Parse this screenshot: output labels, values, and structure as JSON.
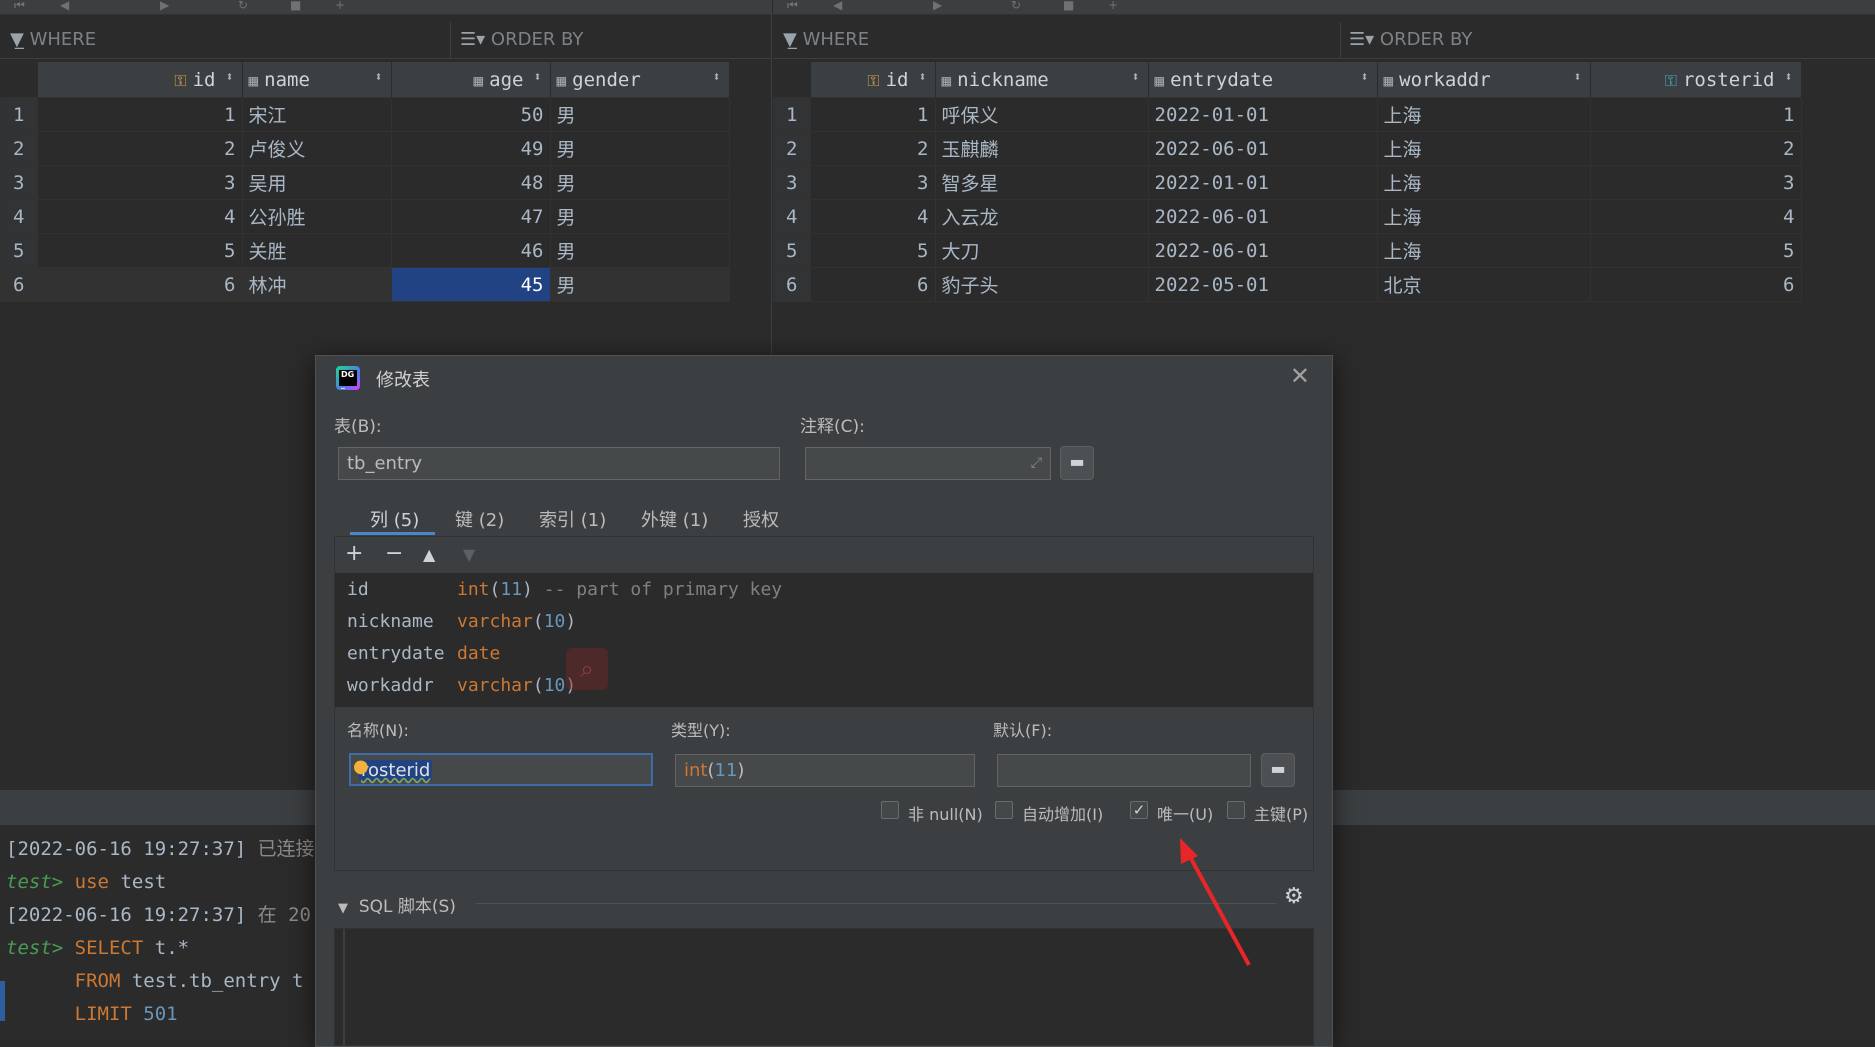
{
  "left_grid": {
    "filter_where": "WHERE",
    "filter_orderby": "ORDER BY",
    "columns": [
      "id",
      "name",
      "age",
      "gender"
    ],
    "rows": [
      [
        "1",
        "1",
        "宋江",
        "50",
        "男"
      ],
      [
        "2",
        "2",
        "卢俊义",
        "49",
        "男"
      ],
      [
        "3",
        "3",
        "吴用",
        "48",
        "男"
      ],
      [
        "4",
        "4",
        "公孙胜",
        "47",
        "男"
      ],
      [
        "5",
        "5",
        "关胜",
        "46",
        "男"
      ],
      [
        "6",
        "6",
        "林冲",
        "45",
        "男"
      ]
    ]
  },
  "right_grid": {
    "filter_where": "WHERE",
    "filter_orderby": "ORDER BY",
    "columns": [
      "id",
      "nickname",
      "entrydate",
      "workaddr",
      "rosterid"
    ],
    "rows": [
      [
        "1",
        "1",
        "呼保义",
        "2022-01-01",
        "上海",
        "1"
      ],
      [
        "2",
        "2",
        "玉麒麟",
        "2022-06-01",
        "上海",
        "2"
      ],
      [
        "3",
        "3",
        "智多星",
        "2022-01-01",
        "上海",
        "3"
      ],
      [
        "4",
        "4",
        "入云龙",
        "2022-06-01",
        "上海",
        "4"
      ],
      [
        "5",
        "5",
        "大刀",
        "2022-06-01",
        "上海",
        "5"
      ],
      [
        "6",
        "6",
        "豹子头",
        "2022-05-01",
        "北京",
        "6"
      ]
    ]
  },
  "console": {
    "line1_time": "[2022-06-16 19:27:37]",
    "line1_text": "已连接",
    "prompt": "test>",
    "use_kw": "use",
    "use_arg": "test",
    "line3_time": "[2022-06-16 19:27:37]",
    "line3_text": "在 20",
    "select_kw": "SELECT",
    "select_arg": "t.*",
    "from_kw": "FROM",
    "from_arg": "test.tb_entry t",
    "limit_kw": "LIMIT",
    "limit_num": "501"
  },
  "dialog": {
    "title": "修改表",
    "table_label": "表(B):",
    "table_value": "tb_entry",
    "comment_label": "注释(C):",
    "tabs": [
      "列 (5)",
      "键 (2)",
      "索引 (1)",
      "外键 (1)",
      "授权"
    ],
    "columns": [
      {
        "name": "id",
        "type": "int",
        "paren_open": "(",
        "size": "11",
        "paren_close": ")",
        "comment": " -- part of primary key"
      },
      {
        "name": "nickname",
        "type": "varchar",
        "paren_open": "(",
        "size": "10",
        "paren_close": ")",
        "comment": ""
      },
      {
        "name": "entrydate",
        "type": "date",
        "paren_open": "",
        "size": "",
        "paren_close": "",
        "comment": ""
      },
      {
        "name": "workaddr",
        "type": "varchar",
        "paren_open": "(",
        "size": "10",
        "paren_close": ")",
        "comment": ""
      }
    ],
    "name_label": "名称(N):",
    "name_value": "rosterid",
    "type_label": "类型(Y):",
    "type_value_kw": "int",
    "type_value_open": "(",
    "type_value_num": "11",
    "type_value_close": ")",
    "default_label": "默认(F):",
    "not_null_label": "非 null(N)",
    "auto_inc_label": "自动增加(I)",
    "unique_label": "唯一(U)",
    "primary_label": "主键(P)",
    "unique_checked": "✓",
    "sql_label": "SQL 脚本(S)"
  },
  "colors": {
    "accent": "#4a88c7",
    "selection": "#214283",
    "keyword": "#cc7832",
    "number": "#6897bb",
    "arrow": "#e8262a"
  }
}
